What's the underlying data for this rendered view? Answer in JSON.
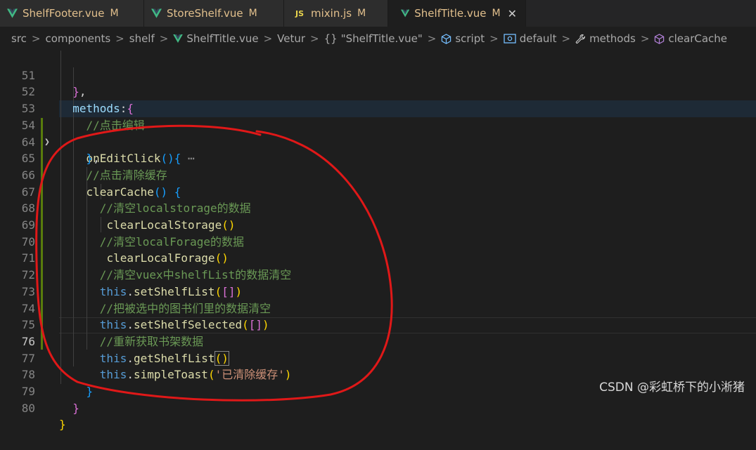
{
  "tabs": [
    {
      "label": "ShelfFooter.vue",
      "status": "M",
      "icon": "vue-icon"
    },
    {
      "label": "StoreShelf.vue",
      "status": "M",
      "icon": "vue-icon"
    },
    {
      "label": "mixin.js",
      "status": "M",
      "icon": "js-icon",
      "icon_text": "JS"
    },
    {
      "label": "ShelfTitle.vue",
      "status": "M",
      "icon": "vue-icon",
      "active": true,
      "close": "✕"
    }
  ],
  "breadcrumb": {
    "items": [
      "src",
      "components",
      "shelf",
      "ShelfTitle.vue",
      "Vetur",
      "\"ShelfTitle.vue\"",
      "script",
      "default",
      "methods",
      "clearCache"
    ],
    "separator": ">",
    "braces_icon": "{}"
  },
  "code_lines": [
    {
      "num": "51",
      "text": "  },"
    },
    {
      "num": "52",
      "text": "  methods:{"
    },
    {
      "num": "53",
      "text": "    //点击编辑"
    },
    {
      "num": "54",
      "text": "    onEditClick(){",
      "folded": "⋯"
    },
    {
      "num": "64",
      "text": "    },"
    },
    {
      "num": "65",
      "text": "    //点击清除缓存"
    },
    {
      "num": "66",
      "text": "    clearCache() {"
    },
    {
      "num": "67",
      "text": "      //清空localstorage的数据"
    },
    {
      "num": "68",
      "text": "       clearLocalStorage()"
    },
    {
      "num": "69",
      "text": "      //清空localForage的数据"
    },
    {
      "num": "70",
      "text": "       clearLocalForage()"
    },
    {
      "num": "71",
      "text": "      //清空vuex中shelfList的数据清空"
    },
    {
      "num": "72",
      "text": "      this.setShelfList([])"
    },
    {
      "num": "73",
      "text": "      //把被选中的图书们里的数据清空"
    },
    {
      "num": "74",
      "text": "      this.setShelfSelected([])"
    },
    {
      "num": "75",
      "text": "      //重新获取书架数据"
    },
    {
      "num": "76",
      "text": "      this.getShelfList()"
    },
    {
      "num": "77",
      "text": "      this.simpleToast('已清除缓存')"
    },
    {
      "num": "78",
      "text": "    }"
    },
    {
      "num": "79",
      "text": "  }"
    },
    {
      "num": "80",
      "text": "}"
    }
  ],
  "watermark": "CSDN @彩虹桥下的小淅猪",
  "colors": {
    "annotation": "#e01818",
    "git_modified": "#587c0c",
    "tab_modified": "#e2c08d"
  }
}
